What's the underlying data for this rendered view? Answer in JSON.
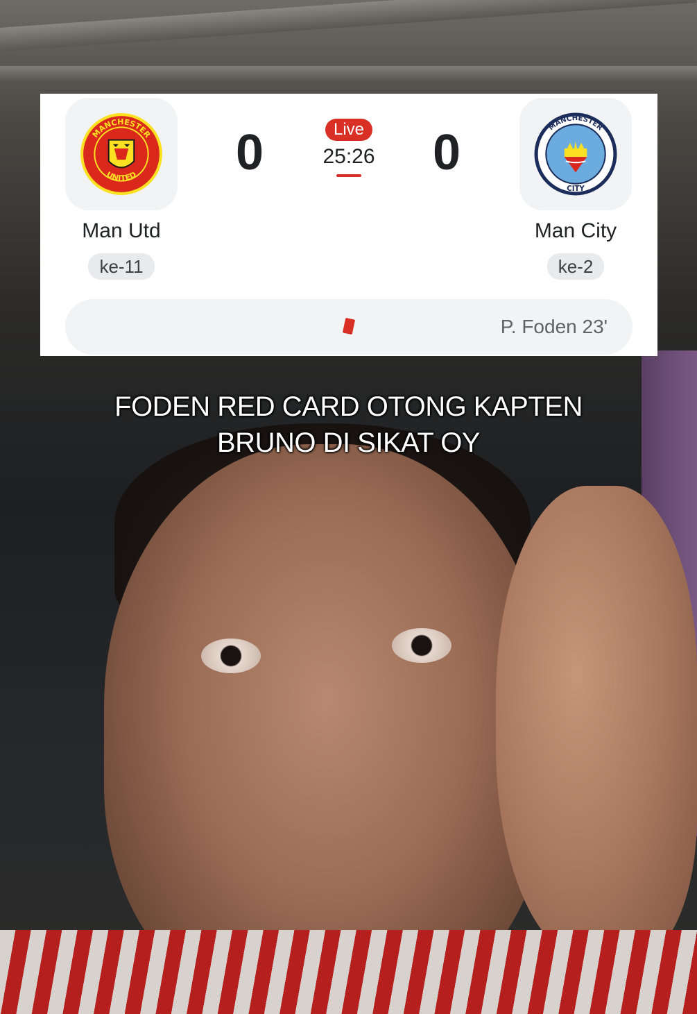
{
  "match": {
    "home": {
      "name": "Man Utd",
      "rank": "ke-11",
      "score": "0",
      "crest_text_top": "MANCHESTER",
      "crest_text_bottom": "UNITED"
    },
    "away": {
      "name": "Man City",
      "rank": "ke-2",
      "score": "0",
      "crest_text_top": "MANCHESTER",
      "crest_text_bottom": "CITY"
    },
    "status": "Live",
    "clock": "25:26",
    "event": {
      "icon": "red-card-icon",
      "text": "P. Foden 23'"
    }
  },
  "caption": {
    "line1": "FODEN RED CARD OTONG KAPTEN",
    "line2": "BRUNO DI SIKAT OY"
  },
  "colors": {
    "live_red": "#d93025",
    "card_bg": "#ffffff",
    "chip_bg": "#e8eaed",
    "man_utd_red": "#da291c",
    "man_utd_gold": "#fbe122",
    "man_city_blue": "#6cabdd",
    "man_city_navy": "#1c2c5b"
  }
}
